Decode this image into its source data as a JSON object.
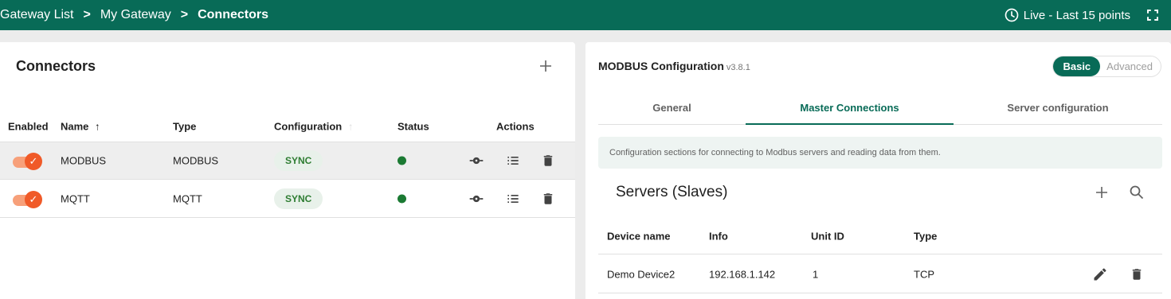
{
  "header": {
    "breadcrumb": [
      "Gateway List",
      "My Gateway",
      "Connectors"
    ],
    "separator": ">",
    "live_label": "Live - Last 15 points",
    "icons": [
      "clock-icon",
      "fullscreen-icon"
    ]
  },
  "connectors": {
    "title": "Connectors",
    "columns": {
      "enabled": "Enabled",
      "name": "Name",
      "name_sort": "↑",
      "type": "Type",
      "configuration": "Configuration",
      "configuration_sort": "↑",
      "status": "Status",
      "actions": "Actions"
    },
    "rows": [
      {
        "enabled": true,
        "name": "MODBUS",
        "type": "MODBUS",
        "configuration": "SYNC",
        "status": "active"
      },
      {
        "enabled": true,
        "name": "MQTT",
        "type": "MQTT",
        "configuration": "SYNC",
        "status": "active"
      }
    ]
  },
  "config_panel": {
    "title": "MODBUS Configuration",
    "version": "v3.8.1",
    "mode": {
      "options": [
        "Basic",
        "Advanced"
      ],
      "selected": "Basic"
    },
    "tabs": [
      "General",
      "Master Connections",
      "Server configuration"
    ],
    "active_tab": "Master Connections",
    "info_text": "Configuration sections for connecting to Modbus servers and reading data from them.",
    "servers": {
      "title": "Servers (Slaves)",
      "columns": {
        "device_name": "Device name",
        "info": "Info",
        "unit_id": "Unit ID",
        "type": "Type"
      },
      "rows": [
        {
          "device_name": "Demo Device2",
          "info": "192.168.1.142",
          "unit_id": "1",
          "type": "TCP"
        }
      ]
    }
  },
  "colors": {
    "brand": "#086b57",
    "toggle_on": "#f05a28",
    "status_active": "#1b7a33",
    "chip_bg": "#e8f1ea",
    "chip_text": "#2e7d32"
  }
}
